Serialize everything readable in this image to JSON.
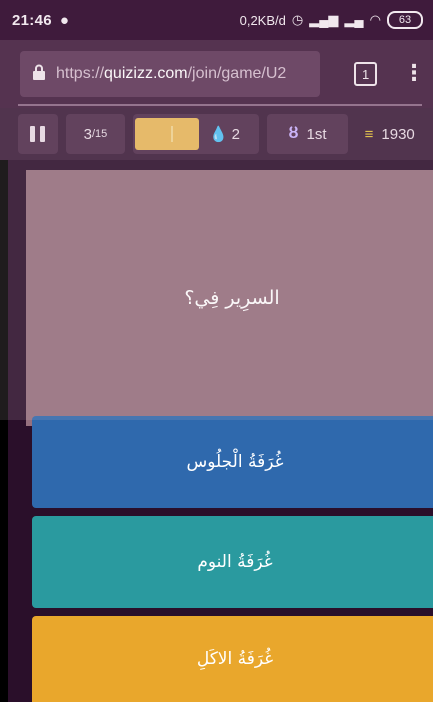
{
  "status_bar": {
    "time": "21:46",
    "network_speed": "0,2KB/d",
    "battery": "63"
  },
  "browser": {
    "url_prefix": "https://",
    "url_domain": "quizizz.com",
    "url_path": "/join/game/U2",
    "tabs_count": "1"
  },
  "quiz_bar": {
    "question_current": "3",
    "question_total": "/15",
    "streak_count": "2",
    "rank": "1st",
    "score": "1930"
  },
  "question": {
    "text": "السرِير فِي؟"
  },
  "options": [
    {
      "label": "غُرَفَةُ الْجلُوس",
      "color": "#2f69ad"
    },
    {
      "label": "غُرَفَةُ النوم",
      "color": "#2a9a9f"
    },
    {
      "label": "غُرَفَةُ الاكَلِ",
      "color": "#e9a72c"
    }
  ],
  "colors": {
    "browser_bg": "#3f1b3c",
    "stage_bg": "#2a0f2a",
    "question_bg": "#95707e"
  }
}
